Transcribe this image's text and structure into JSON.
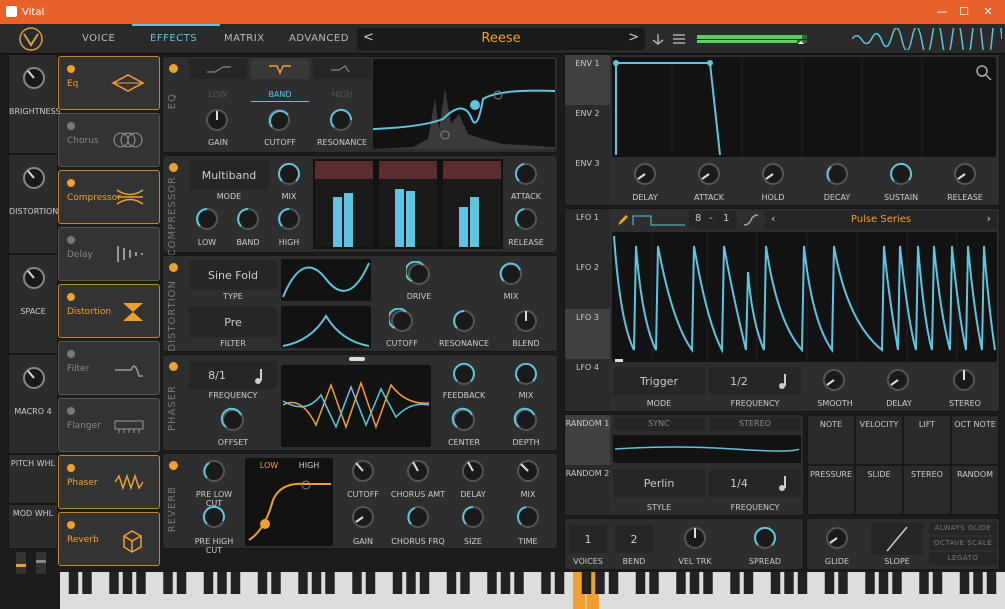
{
  "window": {
    "title": "Vital",
    "min": "—",
    "max": "☐",
    "close": "✕"
  },
  "tabs": [
    "VOICE",
    "EFFECTS",
    "MATRIX",
    "ADVANCED"
  ],
  "preset": {
    "name": "Reese",
    "prev": "<",
    "next": ">"
  },
  "macros": [
    {
      "label": "BRIGHTNESS"
    },
    {
      "label": "DISTORTION"
    },
    {
      "label": "SPACE"
    },
    {
      "label": "MACRO 4"
    }
  ],
  "wheels": [
    {
      "label": "PITCH WHL"
    },
    {
      "label": "MOD WHL"
    }
  ],
  "effects": [
    {
      "label": "Eq",
      "on": true
    },
    {
      "label": "Chorus",
      "on": false
    },
    {
      "label": "Compressor",
      "on": true
    },
    {
      "label": "Delay",
      "on": false
    },
    {
      "label": "Distortion",
      "on": true
    },
    {
      "label": "Filter",
      "on": false
    },
    {
      "label": "Flanger",
      "on": false
    },
    {
      "label": "Phaser",
      "on": true
    },
    {
      "label": "Reverb",
      "on": true
    }
  ],
  "eq": {
    "title": "EQ",
    "bands": [
      "LOW",
      "BAND",
      "HIGH"
    ],
    "knobs": [
      "GAIN",
      "CUTOFF",
      "RESONANCE"
    ]
  },
  "compressor": {
    "title": "COMPRESSOR",
    "mode_value": "Multiband",
    "mode_label": "MODE",
    "mix": "MIX",
    "attack": "ATTACK",
    "release": "RELEASE",
    "knobs": [
      "LOW",
      "BAND",
      "HIGH"
    ]
  },
  "distortion": {
    "title": "DISTORTION",
    "type_value": "Sine Fold",
    "type_label": "TYPE",
    "filter_value": "Pre",
    "filter_label": "FILTER",
    "drive": "DRIVE",
    "mix": "MIX",
    "knobs": [
      "CUTOFF",
      "RESONANCE",
      "BLEND"
    ]
  },
  "phaser": {
    "title": "PHASER",
    "freq_value": "8/1",
    "freq_label": "FREQUENCY",
    "offset": "OFFSET",
    "feedback": "FEEDBACK",
    "mix": "MIX",
    "center": "CENTER",
    "depth": "DEPTH"
  },
  "reverb": {
    "title": "REVERB",
    "knobs_left": [
      "PRE LOW CUT",
      "PRE HIGH CUT"
    ],
    "tabs": [
      "LOW",
      "HIGH"
    ],
    "knobs_top": [
      "CUTOFF",
      "CHORUS AMT",
      "DELAY",
      "MIX"
    ],
    "knobs_bottom": [
      "GAIN",
      "CHORUS FRQ",
      "SIZE",
      "TIME"
    ]
  },
  "env": {
    "tabs": [
      "ENV 1",
      "ENV 2",
      "ENV 3"
    ],
    "knobs": [
      "DELAY",
      "ATTACK",
      "HOLD",
      "DECAY",
      "SUSTAIN",
      "RELEASE"
    ]
  },
  "lfo": {
    "tabs": [
      "LFO 1",
      "LFO 2",
      "LFO 3",
      "LFO 4"
    ],
    "ratio_a": "8",
    "ratio_sep": "-",
    "ratio_b": "1",
    "shape_name": "Pulse Series",
    "mode_value": "Trigger",
    "mode_label": "MODE",
    "freq_value": "1/2",
    "freq_label": "FREQUENCY",
    "smooth": "SMOOTH",
    "delay": "DELAY",
    "stereo": "STEREO"
  },
  "random": {
    "tabs": [
      "RANDOM 1",
      "RANDOM 2"
    ],
    "sync": "SYNC",
    "stereo": "STEREO",
    "style_value": "Perlin",
    "style_label": "STYLE",
    "freq_value": "1/4",
    "freq_label": "FREQUENCY"
  },
  "mod_sources": [
    "NOTE",
    "VELOCITY",
    "LIFT",
    "OCT NOTE",
    "PRESSURE",
    "SLIDE",
    "STEREO",
    "RANDOM"
  ],
  "voice": {
    "voices_value": "1",
    "voices_label": "VOICES",
    "bend_value": "2",
    "bend_label": "BEND",
    "veltrk": "VEL TRK",
    "spread": "SPREAD",
    "glide": "GLIDE",
    "slope": "SLOPE",
    "opts": [
      "ALWAYS GLIDE",
      "OCTAVE SCALE",
      "LEGATO"
    ]
  },
  "colors": {
    "accent": "#5ec5e0",
    "orange": "#f0a030",
    "titlebar": "#e8612a"
  }
}
